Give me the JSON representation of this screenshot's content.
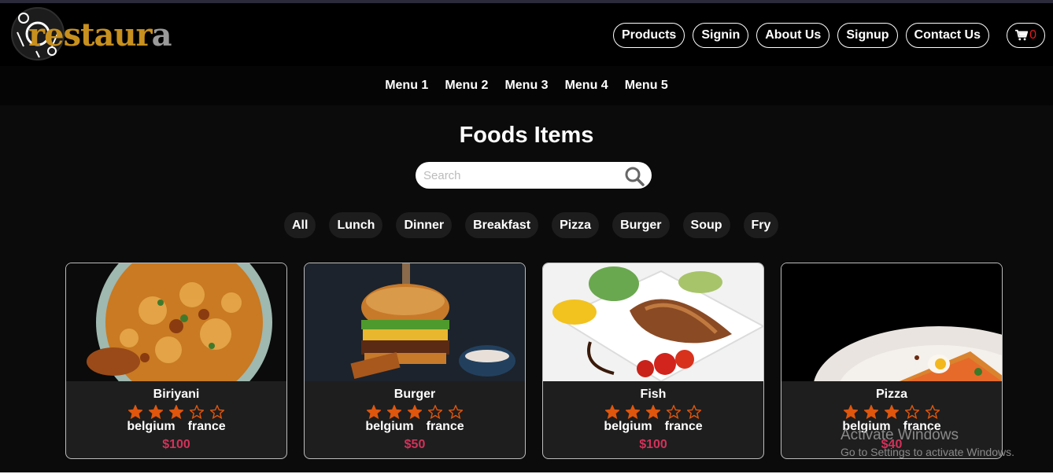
{
  "header": {
    "logo": {
      "main": "restaur",
      "last": "a"
    },
    "nav": [
      "Products",
      "Signin",
      "About Us",
      "Signup",
      "Contact Us"
    ],
    "cart": {
      "icon": "shopping-cart-icon",
      "count": "0"
    }
  },
  "menubar": [
    "Menu 1",
    "Menu 2",
    "Menu 3",
    "Menu 4",
    "Menu 5"
  ],
  "main": {
    "title": "Foods Items",
    "search": {
      "placeholder": "Search",
      "value": "",
      "icon": "search-icon"
    },
    "filters": [
      "All",
      "Lunch",
      "Dinner",
      "Breakfast",
      "Pizza",
      "Burger",
      "Soup",
      "Fry"
    ]
  },
  "cards": [
    {
      "name": "Biriyani",
      "rating": 3,
      "max": 5,
      "tags": [
        "belgium",
        "france"
      ],
      "price": "$100"
    },
    {
      "name": "Burger",
      "rating": 3,
      "max": 5,
      "tags": [
        "belgium",
        "france"
      ],
      "price": "$50"
    },
    {
      "name": "Fish",
      "rating": 3,
      "max": 5,
      "tags": [
        "belgium",
        "france"
      ],
      "price": "$100"
    },
    {
      "name": "Pizza",
      "rating": 3,
      "max": 5,
      "tags": [
        "belgium",
        "france"
      ],
      "price": "$40"
    }
  ],
  "watermark": {
    "line1": "Activate Windows",
    "line2": "Go to Settings to activate Windows."
  },
  "colors": {
    "accent": "#c8901e",
    "star": "#e0560d",
    "price": "#d2325a",
    "cart_count": "#e21b1b"
  }
}
